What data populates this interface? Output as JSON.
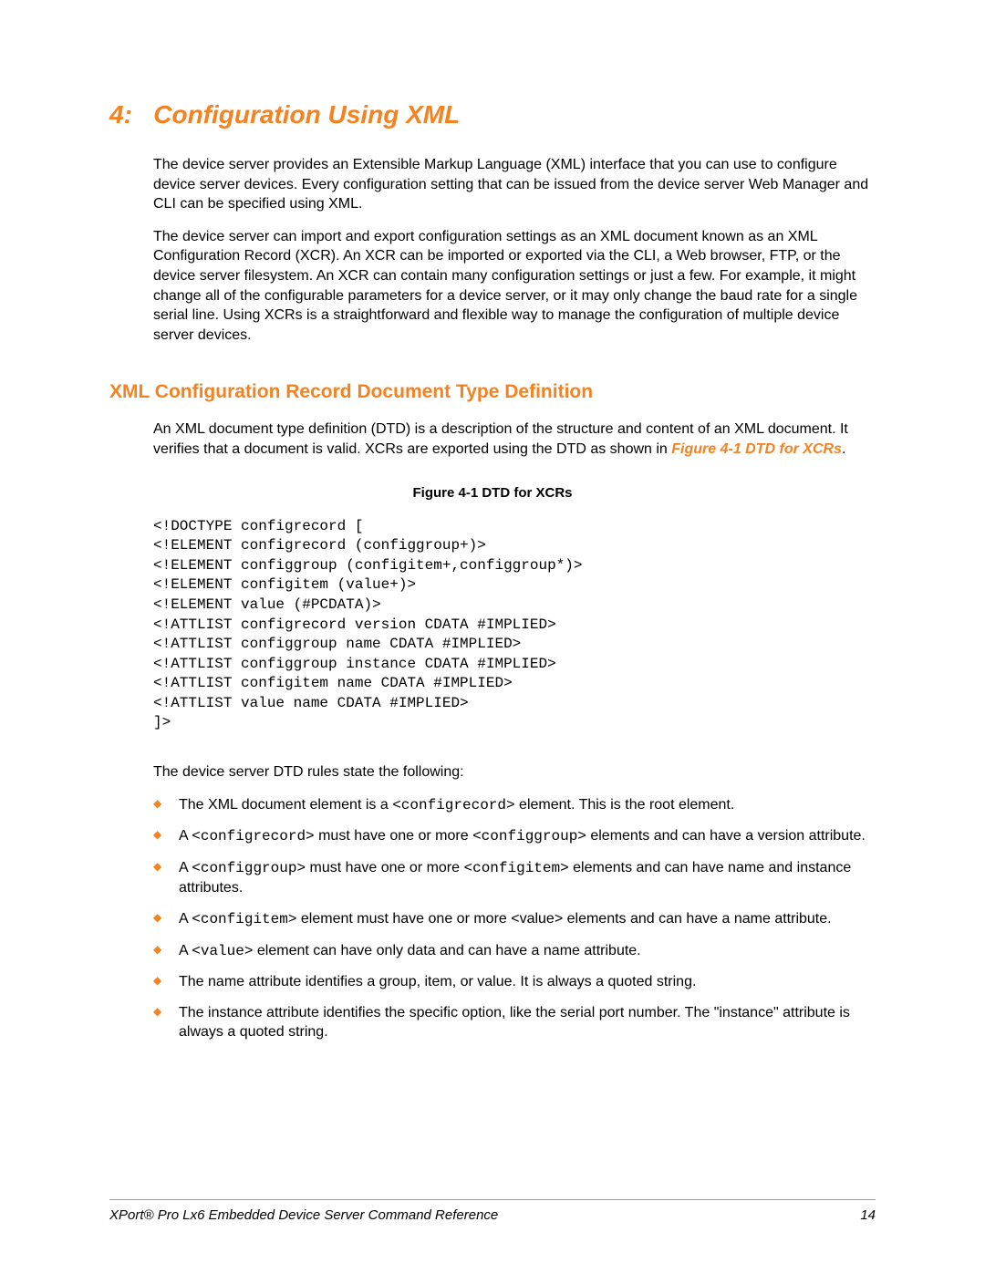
{
  "chapter": {
    "number": "4:",
    "title": "Configuration Using XML"
  },
  "intro": {
    "p1": "The device server provides an Extensible Markup Language (XML) interface that you can use to configure device server devices. Every configuration setting that can be issued from the device server Web Manager and CLI can be specified using XML.",
    "p2": "The device server can import and export configuration settings as an XML document known as an XML Configuration Record (XCR). An XCR can be imported or exported via the CLI, a Web browser, FTP, or the device server filesystem. An XCR can contain many configuration settings or just a few. For example, it might change all of the configurable parameters for a device server, or it may only change the baud rate for a single serial line. Using XCRs is a straightforward and flexible way to manage the configuration of multiple device server devices."
  },
  "section": {
    "title": "XML Configuration Record Document Type Definition",
    "p1_a": "An XML document type definition (DTD) is a description of the structure and content of an XML document. It verifies that a document is valid. XCRs are exported using the DTD as shown in ",
    "figref": "Figure 4-1 DTD for XCRs",
    "p1_b": "."
  },
  "figure": {
    "caption": "Figure 4-1  DTD for XCRs",
    "code": "<!DOCTYPE configrecord [\n<!ELEMENT configrecord (configgroup+)>\n<!ELEMENT configgroup (configitem+,configgroup*)>\n<!ELEMENT configitem (value+)>\n<!ELEMENT value (#PCDATA)>\n<!ATTLIST configrecord version CDATA #IMPLIED>\n<!ATTLIST configgroup name CDATA #IMPLIED>\n<!ATTLIST configgroup instance CDATA #IMPLIED>\n<!ATTLIST configitem name CDATA #IMPLIED>\n<!ATTLIST value name CDATA #IMPLIED>\n]>"
  },
  "rules_intro": "The device server DTD rules state the following:",
  "bullets": {
    "b1_a": "The XML document element is a ",
    "b1_code": "<configrecord>",
    "b1_b": " element. This is the root element.",
    "b2_a": "A ",
    "b2_code1": "<configrecord>",
    "b2_b": " must have one or more ",
    "b2_code2": "<configgroup>",
    "b2_c": " elements and can have a version attribute.",
    "b3_a": "A ",
    "b3_code1": "<configgroup>",
    "b3_b": " must have one or more ",
    "b3_code2": "<configitem>",
    "b3_c": " elements and can have name and instance attributes.",
    "b4_a": "A ",
    "b4_code": "<configitem>",
    "b4_b": " element must have one or more <value> elements and can have a name attribute.",
    "b5_a": "A ",
    "b5_code": "<value>",
    "b5_b": " element can have only data and can have a name attribute.",
    "b6": "The name attribute identifies a group, item, or value. It is always a quoted string.",
    "b7": "The instance attribute identifies the specific option, like the serial port number. The \"instance\" attribute is always a quoted string."
  },
  "footer": {
    "doc_title": "XPort® Pro Lx6 Embedded Device Server Command Reference",
    "page_number": "14"
  }
}
